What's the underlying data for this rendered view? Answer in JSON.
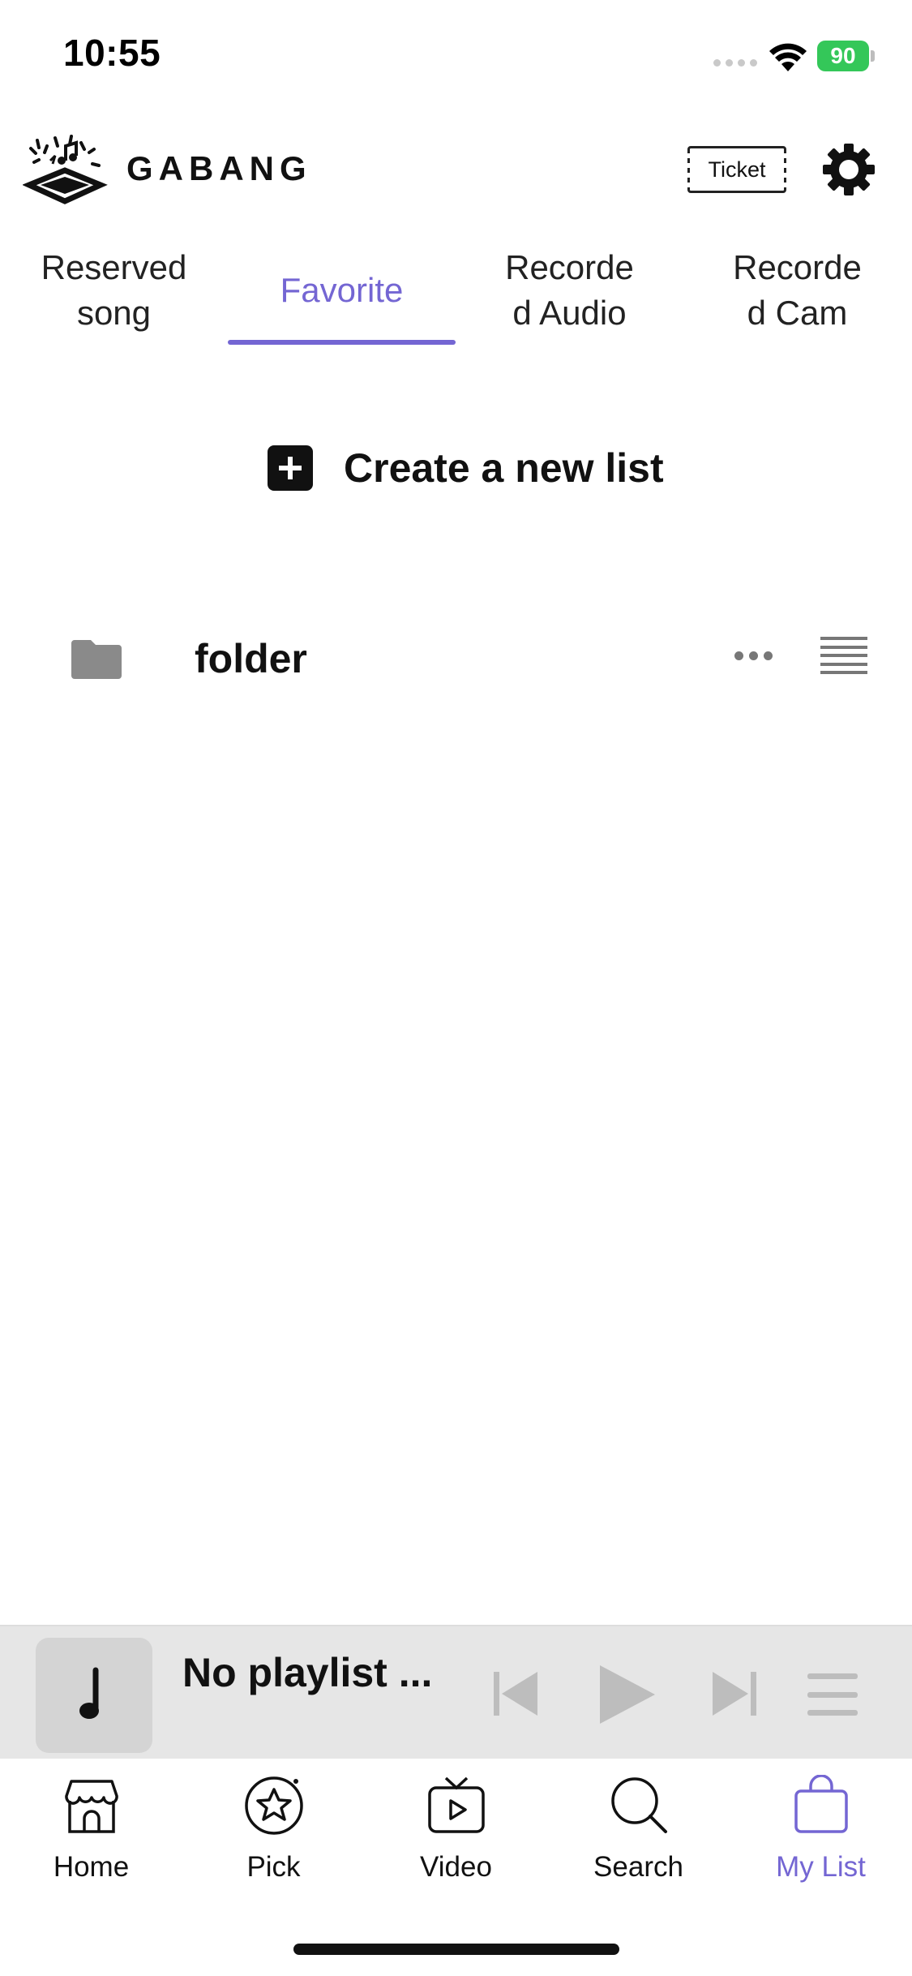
{
  "status_bar": {
    "time": "10:55",
    "battery": "90"
  },
  "header": {
    "logo_text": "GABANG",
    "ticket_label": "Ticket"
  },
  "tabs": [
    {
      "label": "Reserved\nsong"
    },
    {
      "label": "Favorite"
    },
    {
      "label": "Recorde\nd Audio"
    },
    {
      "label": "Recorde\nd Cam"
    }
  ],
  "active_tab": "Favorite",
  "create": {
    "label": "Create a new list"
  },
  "folders": [
    {
      "name": "folder"
    }
  ],
  "player": {
    "title": "No playlist ..."
  },
  "nav": [
    {
      "label": "Home",
      "icon": "home-icon"
    },
    {
      "label": "Pick",
      "icon": "star-circle-icon"
    },
    {
      "label": "Video",
      "icon": "tv-play-icon"
    },
    {
      "label": "Search",
      "icon": "search-icon"
    },
    {
      "label": "My List",
      "icon": "bag-icon"
    }
  ],
  "colors": {
    "accent": "#7466d3",
    "battery": "#34c759",
    "player_bg": "#e6e6e6"
  }
}
